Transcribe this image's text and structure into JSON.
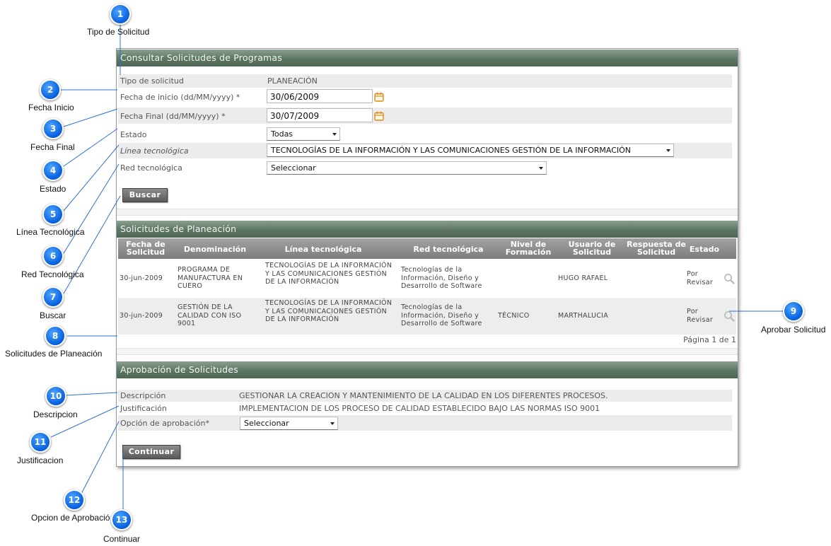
{
  "colors": {
    "header": "#5d7563",
    "badge": "#0a63e0",
    "line": "#2d6fd6"
  },
  "consultar": {
    "title": "Consultar Solicitudes de Programas",
    "tipo_label": "Tipo de solicitud",
    "tipo_value": "PLANEACIÓN",
    "fecha_inicio_label": "Fecha de inicio (dd/MM/yyyy) *",
    "fecha_inicio_value": "30/06/2009",
    "fecha_final_label": "Fecha Final (dd/MM/yyyy) *",
    "fecha_final_value": "30/07/2009",
    "estado_label": "Estado",
    "estado_value": "Todas",
    "linea_label": "Línea tecnológica",
    "linea_value": "TECNOLOGÍAS DE LA INFORMACIÓN Y LAS COMUNICACIONES GESTIÓN DE LA INFORMACIÓN",
    "red_label": "Red tecnológica",
    "red_value": "Seleccionar",
    "buscar_label": "Buscar",
    "calendar_icon": "calendar-icon"
  },
  "planeacion": {
    "title": "Solicitudes de Planeación",
    "columns": [
      "Fecha de Solicitud",
      "Denominación",
      "Línea tecnológica",
      "Red tecnológica",
      "Nivel de Formación",
      "Usuario de Solicitud",
      "Respuesta de Solicitud",
      "Estado"
    ],
    "rows": [
      {
        "fecha": "30-jun-2009",
        "denominacion": "PROGRAMA DE MANUFACTURA EN CUERO",
        "linea": "TECNOLOGÍAS DE LA INFORMACIÓN Y LAS COMUNICACIONES GESTIÓN DE LA INFORMACIÓN",
        "red": "Tecnologías de la Información, Diseño y Desarrollo de Software",
        "nivel": "",
        "usuario": "HUGO RAFAEL",
        "respuesta": "",
        "estado": "Por Revisar"
      },
      {
        "fecha": "30-jun-2009",
        "denominacion": "GESTIÓN DE LA CALIDAD CON ISO 9001",
        "linea": "TECNOLOGÍAS DE LA INFORMACIÓN Y LAS COMUNICACIONES GESTIÓN DE LA INFORMACIÓN",
        "red": "Tecnologías de la Información, Diseño y Desarrollo de Software",
        "nivel": "TÉCNICO",
        "usuario": "MARTHALUCIA",
        "respuesta": "",
        "estado": "Por Revisar"
      }
    ],
    "pager": "Página 1 de 1",
    "action_icon": "search-icon"
  },
  "aprobacion": {
    "title": "Aprobación de Solicitudes",
    "descripcion_label": "Descripción",
    "descripcion_value": "GESTIONAR LA CREACION Y MANTENIMIENTO DE LA CALIDAD EN LOS DIFERENTES PROCESOS.",
    "justificacion_label": "Justificación",
    "justificacion_value": "IMPLEMENTACION DE LOS PROCESO DE CALIDAD ESTABLECIDO BAJO LAS NORMAS ISO 9001",
    "opcion_label": "Opción de aprobación*",
    "opcion_value": "Seleccionar",
    "continuar_label": "Continuar"
  },
  "callouts": [
    {
      "n": "1",
      "label": "Tipo de Solicitud"
    },
    {
      "n": "2",
      "label": "Fecha Inicio"
    },
    {
      "n": "3",
      "label": "Fecha Final"
    },
    {
      "n": "4",
      "label": "Estado"
    },
    {
      "n": "5",
      "label": "Línea Tecnológica"
    },
    {
      "n": "6",
      "label": "Red Tecnológica"
    },
    {
      "n": "7",
      "label": "Buscar"
    },
    {
      "n": "8",
      "label": "Solicitudes de Planeación"
    },
    {
      "n": "9",
      "label": "Aprobar Solicitud"
    },
    {
      "n": "10",
      "label": "Descripcion"
    },
    {
      "n": "11",
      "label": "Justificacion"
    },
    {
      "n": "12",
      "label": "Opcion de Aprobación"
    },
    {
      "n": "13",
      "label": "Continuar"
    }
  ]
}
